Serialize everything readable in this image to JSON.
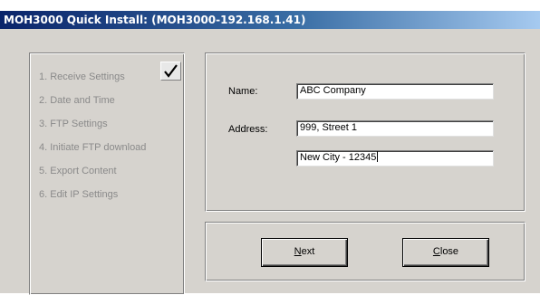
{
  "window": {
    "title": "MOH3000 Quick Install: (MOH3000-192.168.1.41)"
  },
  "steps": {
    "items": [
      {
        "label": "1. Receive Settings"
      },
      {
        "label": "2. Date and Time"
      },
      {
        "label": "3. FTP Settings"
      },
      {
        "label": "4. Initiate FTP download"
      },
      {
        "label": "5. Export Content"
      },
      {
        "label": "6. Edit IP Settings"
      }
    ],
    "completed_icon": "checkmark-icon"
  },
  "form": {
    "name_label": "Name:",
    "name_value": "ABC Company",
    "address_label": "Address:",
    "address_line1": "999, Street 1",
    "address_line2": "New City - 12345"
  },
  "buttons": {
    "next_mnemonic": "N",
    "next_rest": "ext",
    "close_mnemonic": "C",
    "close_rest": "lose"
  },
  "colors": {
    "title_bar": "#0a246a",
    "window_bg": "#d6d3ce",
    "disabled_text": "#8a8a8a"
  }
}
